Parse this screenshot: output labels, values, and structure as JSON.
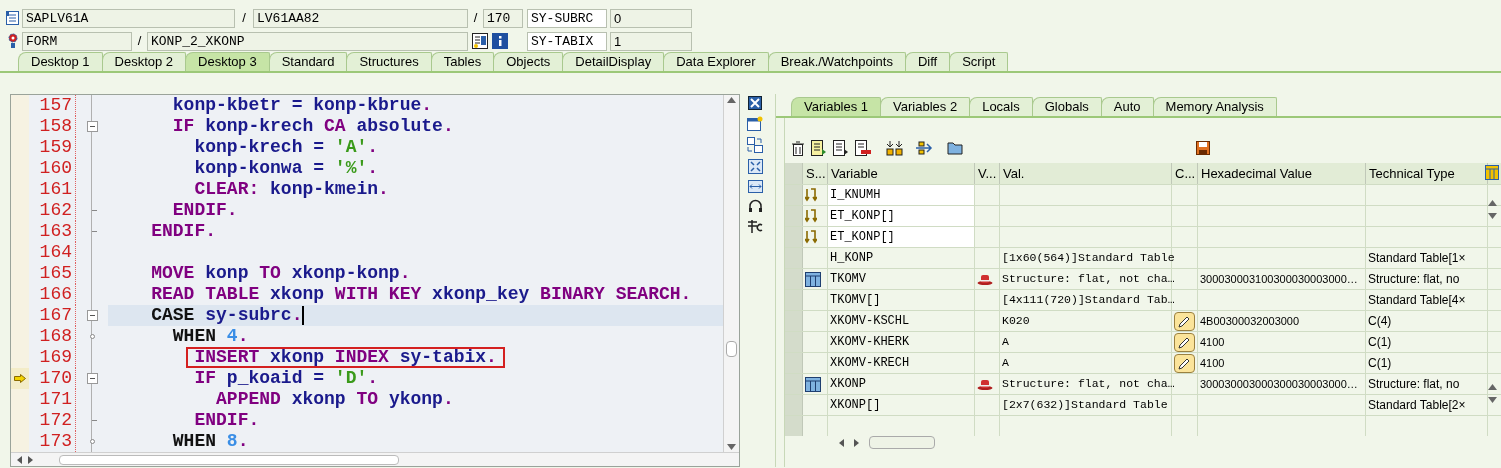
{
  "top_rows": [
    {
      "items": [
        {
          "kind": "field",
          "text": "SAPLV61A"
        },
        {
          "kind": "separator",
          "text": "/"
        },
        {
          "kind": "field",
          "text": "LV61AA82"
        },
        {
          "kind": "separator",
          "text": "/"
        },
        {
          "kind": "field",
          "text": "170"
        }
      ],
      "system_field": {
        "name": "SY-SUBRC",
        "value": "0"
      }
    },
    {
      "items": [
        {
          "kind": "field",
          "text": "FORM"
        },
        {
          "kind": "separator",
          "text": "/"
        },
        {
          "kind": "field",
          "text": "KONP_2_XKONP"
        },
        {
          "kind": "buttons"
        }
      ],
      "system_field": {
        "name": "SY-TABIX",
        "value": "1"
      }
    }
  ],
  "desktop_tabs": [
    {
      "label": "Desktop 1",
      "selected": false
    },
    {
      "label": "Desktop 2",
      "selected": false
    },
    {
      "label": "Desktop 3",
      "selected": true
    },
    {
      "label": "Standard",
      "selected": false
    },
    {
      "label": "Structures",
      "selected": false
    },
    {
      "label": "Tables",
      "selected": false
    },
    {
      "label": "Objects",
      "selected": false
    },
    {
      "label": "DetailDisplay",
      "selected": false
    },
    {
      "label": "Data Explorer",
      "selected": false
    },
    {
      "label": "Break./Watchpoints",
      "selected": false
    },
    {
      "label": "Diff",
      "selected": false
    },
    {
      "label": "Script",
      "selected": false
    }
  ],
  "code": {
    "lines": [
      {
        "number": "157",
        "kind": "none",
        "cursor": false,
        "current": false,
        "boxed": false,
        "tokens": [
          {
            "kind": "id",
            "text": "      konp-kbetr = konp-kbrue"
          },
          {
            "kind": "punct",
            "text": "."
          }
        ]
      },
      {
        "number": "158",
        "kind": "collapse",
        "cursor": false,
        "current": false,
        "boxed": false,
        "tokens": [
          {
            "kind": "kw",
            "text": "      IF "
          },
          {
            "kind": "id",
            "text": "konp-krech "
          },
          {
            "kind": "kw",
            "text": "CA "
          },
          {
            "kind": "id",
            "text": "absolute"
          },
          {
            "kind": "punct",
            "text": "."
          }
        ]
      },
      {
        "number": "159",
        "kind": "none",
        "cursor": false,
        "current": false,
        "boxed": false,
        "tokens": [
          {
            "kind": "id",
            "text": "        konp-krech = "
          },
          {
            "kind": "str",
            "text": "'A'"
          },
          {
            "kind": "punct",
            "text": "."
          }
        ]
      },
      {
        "number": "160",
        "kind": "none",
        "cursor": false,
        "current": false,
        "boxed": false,
        "tokens": [
          {
            "kind": "id",
            "text": "        konp-konwa = "
          },
          {
            "kind": "str",
            "text": "'%'"
          },
          {
            "kind": "punct",
            "text": "."
          }
        ]
      },
      {
        "number": "161",
        "kind": "none",
        "cursor": false,
        "current": false,
        "boxed": false,
        "tokens": [
          {
            "kind": "kw",
            "text": "        CLEAR: "
          },
          {
            "kind": "id",
            "text": "konp-kmein"
          },
          {
            "kind": "punct",
            "text": "."
          }
        ]
      },
      {
        "number": "162",
        "kind": "end",
        "cursor": false,
        "current": false,
        "boxed": false,
        "tokens": [
          {
            "kind": "kw",
            "text": "      ENDIF."
          }
        ]
      },
      {
        "number": "163",
        "kind": "end",
        "cursor": false,
        "current": false,
        "boxed": false,
        "tokens": [
          {
            "kind": "kw",
            "text": "    ENDIF."
          }
        ]
      },
      {
        "number": "164",
        "kind": "none",
        "cursor": false,
        "current": false,
        "boxed": false
      },
      {
        "number": "165",
        "kind": "none",
        "cursor": false,
        "current": false,
        "boxed": false,
        "tokens": [
          {
            "kind": "kw",
            "text": "    MOVE "
          },
          {
            "kind": "id",
            "text": "konp "
          },
          {
            "kind": "kw",
            "text": "TO "
          },
          {
            "kind": "id",
            "text": "xkonp-konp"
          },
          {
            "kind": "punct",
            "text": "."
          }
        ]
      },
      {
        "number": "166",
        "kind": "none",
        "cursor": false,
        "current": false,
        "boxed": false,
        "tokens": [
          {
            "kind": "kw",
            "text": "    READ TABLE "
          },
          {
            "kind": "id",
            "text": "xkonp "
          },
          {
            "kind": "kw",
            "text": "WITH KEY "
          },
          {
            "kind": "id",
            "text": "xkonp_key "
          },
          {
            "kind": "kw",
            "text": "BINARY SEARCH"
          },
          {
            "kind": "punct",
            "text": "."
          }
        ]
      },
      {
        "number": "167",
        "kind": "collapse",
        "cursor": true,
        "current": false,
        "boxed": false,
        "tokens": [
          {
            "kind": "kw2",
            "text": "    CASE "
          },
          {
            "kind": "id",
            "text": "sy-subrc"
          },
          {
            "kind": "punct",
            "text": "."
          }
        ]
      },
      {
        "number": "168",
        "kind": "branch",
        "cursor": false,
        "current": false,
        "boxed": false,
        "tokens": [
          {
            "kind": "kw2",
            "text": "      WHEN "
          },
          {
            "kind": "num",
            "text": "4"
          },
          {
            "kind": "punct",
            "text": "."
          }
        ]
      },
      {
        "number": "169",
        "kind": "none",
        "cursor": false,
        "current": false,
        "boxed": true,
        "tokens": [
          {
            "kind": "kw",
            "text": "        INSERT "
          },
          {
            "kind": "id",
            "text": "xkonp "
          },
          {
            "kind": "kw",
            "text": "INDEX "
          },
          {
            "kind": "id",
            "text": "sy-tabix"
          },
          {
            "kind": "punct",
            "text": "."
          }
        ]
      },
      {
        "number": "170",
        "kind": "collapse",
        "cursor": false,
        "current": true,
        "boxed": false,
        "tokens": [
          {
            "kind": "kw",
            "text": "        IF "
          },
          {
            "kind": "id",
            "text": "p_koaid = "
          },
          {
            "kind": "str",
            "text": "'D'"
          },
          {
            "kind": "punct",
            "text": "."
          }
        ]
      },
      {
        "number": "171",
        "kind": "none",
        "cursor": false,
        "current": false,
        "boxed": false,
        "tokens": [
          {
            "kind": "kw",
            "text": "          APPEND "
          },
          {
            "kind": "id",
            "text": "xkonp "
          },
          {
            "kind": "kw",
            "text": "TO "
          },
          {
            "kind": "id",
            "text": "ykonp"
          },
          {
            "kind": "punct",
            "text": "."
          }
        ]
      },
      {
        "number": "172",
        "kind": "end",
        "cursor": false,
        "current": false,
        "boxed": false,
        "tokens": [
          {
            "kind": "kw",
            "text": "        ENDIF."
          }
        ]
      },
      {
        "number": "173",
        "kind": "branch",
        "cursor": false,
        "current": false,
        "boxed": false,
        "tokens": [
          {
            "kind": "kw2",
            "text": "      WHEN "
          },
          {
            "kind": "num",
            "text": "8"
          },
          {
            "kind": "punct",
            "text": "."
          }
        ]
      }
    ]
  },
  "variable_tabs": [
    {
      "label": "Variables 1",
      "selected": true
    },
    {
      "label": "Variables 2",
      "selected": false
    },
    {
      "label": "Locals",
      "selected": false
    },
    {
      "label": "Globals",
      "selected": false
    },
    {
      "label": "Auto",
      "selected": false
    },
    {
      "label": "Memory Analysis",
      "selected": false
    }
  ],
  "variables": {
    "columns": [
      "S...",
      "Variable",
      "V...",
      "Val.",
      "C...",
      "Hexadecimal Value",
      "Technical Type"
    ],
    "rows": [
      {
        "kind": "import",
        "variable": "I_KNUMH",
        "editable": false
      },
      {
        "kind": "import",
        "variable": "ET_KONP[]",
        "editable": false
      },
      {
        "kind": "import",
        "variable": "ET_KONP[]",
        "editable": false
      },
      {
        "kind": "plain",
        "variable": "H_KONP",
        "value": "[1x60(564)]Standard Table",
        "editable": false,
        "type": "Standard Table[1×"
      },
      {
        "kind": "structure",
        "variable": "TKOMV",
        "value": "Structure: flat, not cha…",
        "editable": false,
        "hex": "300030003100300030003000…",
        "type": "Structure: flat, no"
      },
      {
        "kind": "plain",
        "variable": "TKOMV[]",
        "value": "[4x111(720)]Standard Tab…",
        "editable": false,
        "type": "Standard Table[4×"
      },
      {
        "kind": "plain",
        "variable": "XKOMV-KSCHL",
        "value": "K020",
        "editable": true,
        "hex": "4B00300032003000",
        "type": "C(4)"
      },
      {
        "kind": "plain",
        "variable": "XKOMV-KHERK",
        "value": "A",
        "editable": true,
        "hex": "4100",
        "type": "C(1)"
      },
      {
        "kind": "plain",
        "variable": "XKOMV-KRECH",
        "value": "A",
        "editable": true,
        "hex": "4100",
        "type": "C(1)"
      },
      {
        "kind": "structure",
        "variable": "XKONP",
        "value": "Structure: flat, not cha…",
        "editable": false,
        "hex": "300030003000300030003000…",
        "type": "Structure: flat, no"
      },
      {
        "kind": "plain",
        "variable": "XKONP[]",
        "value": "[2x7(632)]Standard Table",
        "editable": false,
        "type": "Standard Table[2×"
      }
    ]
  }
}
